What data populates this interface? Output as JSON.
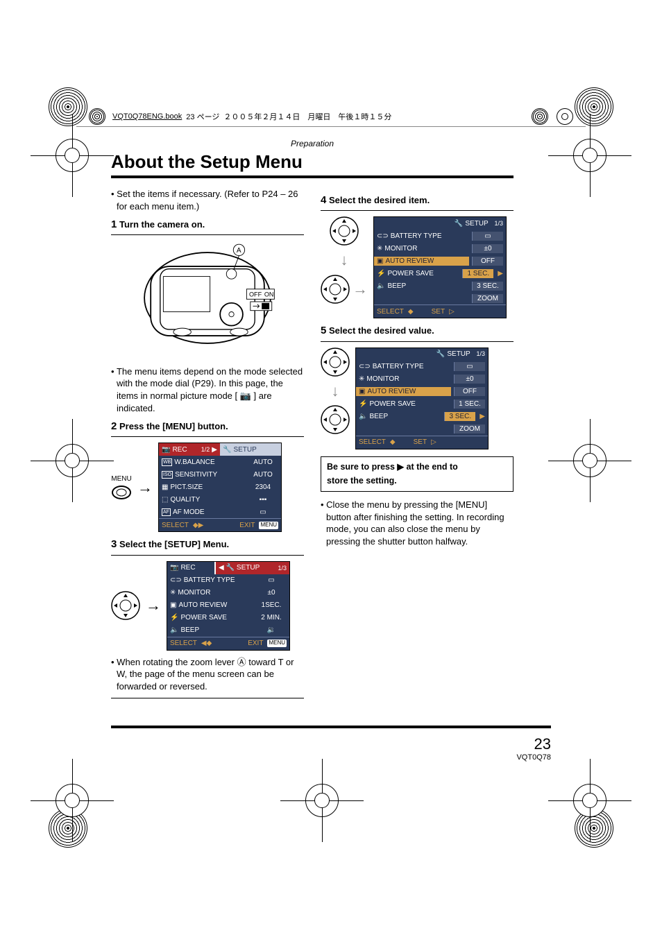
{
  "book_header": {
    "filename": "VQT0Q78ENG.book",
    "page_jp": "23 ページ",
    "date_jp": "２００５年２月１４日　月曜日　午後１時１５分"
  },
  "section": "Preparation",
  "title": "About the Setup Menu",
  "intro_bullet": "Set the items if necessary. (Refer to P24 – 26 for each menu item.)",
  "steps": {
    "s1": {
      "num": "1",
      "text": "Turn the camera on."
    },
    "s2": {
      "num": "2",
      "text": "Press the [MENU] button."
    },
    "s3": {
      "num": "3",
      "text": "Select the [SETUP] Menu."
    },
    "s4": {
      "num": "4",
      "text": "Select the desired item."
    },
    "s5": {
      "num": "5",
      "text": "Select the desired value."
    }
  },
  "camera_switch": {
    "off": "OFF",
    "on": "ON",
    "marker": "A"
  },
  "note_after_s1": "The menu items depend on the mode selected with the mode dial (P29). In this page, the items in normal picture mode [ 📷 ] are indicated.",
  "menu_btn_label": "MENU",
  "lcd_rec": {
    "tab_left": "REC",
    "page": "1/2",
    "tab_right": "SETUP",
    "rows": [
      {
        "icon": "WB",
        "label": "W.BALANCE",
        "value": "AUTO"
      },
      {
        "icon": "ISO",
        "label": "SENSITIVITY",
        "value": "AUTO"
      },
      {
        "icon": "SZ",
        "label": "PICT.SIZE",
        "value": "2304"
      },
      {
        "icon": "Q",
        "label": "QUALITY",
        "value": "␋"
      },
      {
        "icon": "AF",
        "label": "AF MODE",
        "value": "▭"
      }
    ],
    "foot_select": "SELECT",
    "foot_exit": "EXIT",
    "foot_menu": "MENU"
  },
  "lcd_setup_a": {
    "tab_left": "REC",
    "tab_right": "SETUP",
    "page": "1/3",
    "rows": [
      {
        "label": "BATTERY TYPE",
        "value": "▭"
      },
      {
        "label": "MONITOR",
        "value": "±0"
      },
      {
        "label": "AUTO REVIEW",
        "value": "1SEC."
      },
      {
        "label": "POWER SAVE",
        "value": "2 MIN."
      },
      {
        "label": "BEEP",
        "value": "🔉"
      }
    ],
    "foot_select": "SELECT",
    "foot_exit": "EXIT",
    "foot_menu": "MENU"
  },
  "note_after_s3": "When rotating the zoom lever Ⓐ toward T or W, the page of the menu screen can be forwarded or reversed.",
  "lcd_step4": {
    "tab_right": "SETUP",
    "page": "1/3",
    "rows": [
      {
        "label": "BATTERY TYPE",
        "value": "▭"
      },
      {
        "label": "MONITOR",
        "value": "±0"
      },
      {
        "label": "AUTO REVIEW",
        "value": "OFF",
        "hl_label": true
      },
      {
        "label": "POWER SAVE",
        "value": "1 SEC.",
        "hl_value": true
      },
      {
        "label": "BEEP",
        "value": "3 SEC."
      }
    ],
    "extra_row": {
      "value": "ZOOM"
    },
    "foot_select": "SELECT",
    "foot_set": "SET"
  },
  "lcd_step5": {
    "tab_right": "SETUP",
    "page": "1/3",
    "rows": [
      {
        "label": "BATTERY TYPE",
        "value": "▭"
      },
      {
        "label": "MONITOR",
        "value": "±0"
      },
      {
        "label": "AUTO REVIEW",
        "value": "OFF",
        "hl_label": true
      },
      {
        "label": "POWER SAVE",
        "value": "1 SEC."
      },
      {
        "label": "BEEP",
        "value": "3 SEC.",
        "hl_value": true
      }
    ],
    "extra_row": {
      "value": "ZOOM"
    },
    "foot_select": "SELECT",
    "foot_set": "SET"
  },
  "press_note_1": "Be sure to press ▶ at the end to",
  "press_note_2": "store the setting.",
  "closing_bullet": "Close the menu by pressing the [MENU] button after finishing the setting. In recording mode, you can also close the menu by pressing the shutter button halfway.",
  "page_number": "23",
  "doc_code": "VQT0Q78"
}
